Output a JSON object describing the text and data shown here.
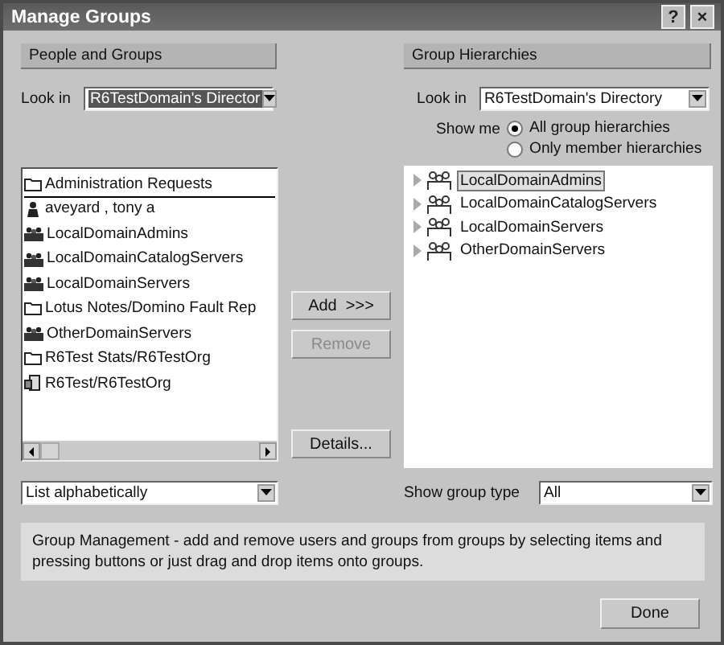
{
  "window": {
    "title": "Manage Groups",
    "help_button": "?",
    "close_button": "×"
  },
  "left_panel": {
    "header": "People and Groups",
    "look_in_label": "Look in",
    "look_in_value": "R6TestDomain's Director",
    "items": [
      {
        "kind": "folder",
        "label": "Administration Requests",
        "selected": true
      },
      {
        "kind": "person",
        "label": "aveyard , tony a",
        "selected": false
      },
      {
        "kind": "group",
        "label": "LocalDomainAdmins",
        "selected": false
      },
      {
        "kind": "group",
        "label": "LocalDomainCatalogServers",
        "selected": false
      },
      {
        "kind": "group",
        "label": "LocalDomainServers",
        "selected": false
      },
      {
        "kind": "folder",
        "label": "Lotus Notes/Domino Fault Rep",
        "selected": false
      },
      {
        "kind": "group",
        "label": "OtherDomainServers",
        "selected": false
      },
      {
        "kind": "folder",
        "label": "R6Test Stats/R6TestOrg",
        "selected": false
      },
      {
        "kind": "server",
        "label": "R6Test/R6TestOrg",
        "selected": false
      }
    ],
    "sort_value": "List alphabetically"
  },
  "middle_buttons": [
    {
      "label": "Add  >>>",
      "disabled": false
    },
    {
      "label": "Remove",
      "disabled": true
    },
    {
      "label": "Details...",
      "disabled": false
    }
  ],
  "right_panel": {
    "header": "Group Hierarchies",
    "look_in_label": "Look in",
    "look_in_value": "R6TestDomain's Directory",
    "show_me_label": "Show me",
    "options": [
      {
        "label": "All group hierarchies",
        "selected": true
      },
      {
        "label": "Only member hierarchies",
        "selected": false
      }
    ],
    "tree": [
      {
        "label": "LocalDomainAdmins",
        "selected": true
      },
      {
        "label": "LocalDomainCatalogServers",
        "selected": false
      },
      {
        "label": "LocalDomainServers",
        "selected": false
      },
      {
        "label": "OtherDomainServers",
        "selected": false
      }
    ],
    "group_type_label": "Show group type",
    "group_type_value": "All"
  },
  "info": "Group Management - add and remove users and groups from groups by selecting items and pressing buttons or just drag and drop items onto groups.",
  "done_button": "Done"
}
